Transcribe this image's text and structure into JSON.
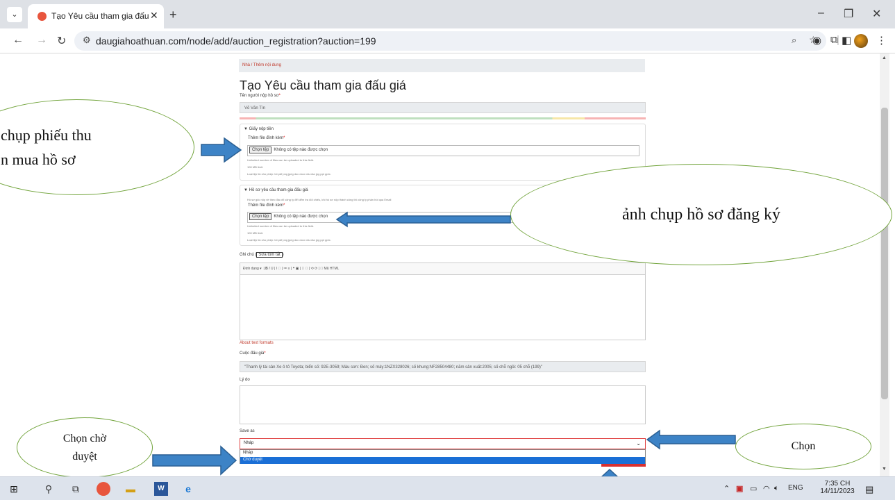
{
  "browser": {
    "tab_title": "Tạo Yêu cầu tham gia đấu giá |",
    "url": "daugiahoathuan.com/node/add/auction_registration?auction=199"
  },
  "page": {
    "breadcrumb": "Nhà / Thêm nội dung",
    "title": "Tạo Yêu cầu tham gia đấu giá",
    "submitter_label": "Tên người nộp hồ sơ",
    "submitter_value": "Võ Văn Tín",
    "fieldset1": {
      "legend": "Giấy nộp tiền",
      "attach_label": "Thêm file đính kèm",
      "file_button": "Chọn tệp",
      "file_status": "Không có tệp nào được chọn",
      "help1": "Unlimited number of files can be uploaded to this field.",
      "help2": "100 MB limit.",
      "help3": "Loại tệp tin cho phép: txt pdf png jpeg doc docx xls xlsx jpg ppt pptx."
    },
    "fieldset2": {
      "legend": "Hồ sơ yêu cầu tham gia đấu giá",
      "description": "Hồ sơ gốc nộp về theo địa chỉ công ty để kiểm tra đối chiếu, khi hồ sơ nộp thành công thì công ty phản hồi qua Email",
      "attach_label": "Thêm file đính kèm",
      "file_button": "Chọn tệp",
      "file_status": "Không có tệp nào được chọn",
      "help1": "Unlimited number of files can be uploaded to this field.",
      "help2": "100 MB limit.",
      "help3": "Loại tệp tin cho phép: txt pdf png jpeg doc docx xls xlsx jpg ppt pptx."
    },
    "note_label": "Ghi chú",
    "edit_summary": "Sửa tóm tắt",
    "editor_format": "Định dạng",
    "editor_source": "Mã HTML",
    "about_formats": "About text formats",
    "auction_label": "Cuộc đấu giá",
    "auction_value": "\"Thanh lý tài sản Xe ô tô Toyota; biển số: 92E-3059; Màu sơn: Đen; số máy:1NZX328026; số khung:NF28504480; năm sản xuất:2005; số chỗ ngồi: 05 chỗ (199)\"",
    "reason_label": "Lý do",
    "save_as_label": "Save as",
    "save_as_value": "Nháp",
    "options": [
      "Nháp",
      "Chờ duyệt"
    ]
  },
  "annotations": {
    "receipt": [
      "chụp phiếu thu",
      "n mua hồ sơ"
    ],
    "dossier": "ảnh chụp hồ sơ đăng ký",
    "choose_pending": [
      "Chọn chờ",
      "duyệt"
    ],
    "choose": "Chọn"
  },
  "taskbar": {
    "lang": "ENG",
    "time": "7:35 CH",
    "date": "14/11/2023"
  }
}
